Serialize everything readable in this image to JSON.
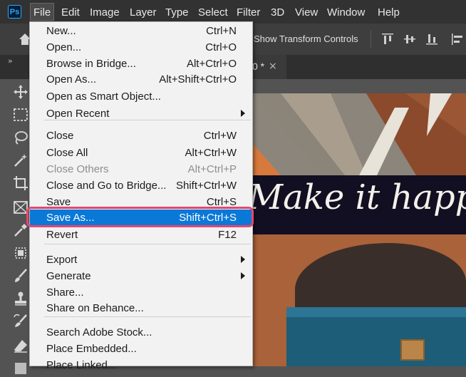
{
  "app": {
    "logo_text": "Ps"
  },
  "menubar": {
    "items": [
      "File",
      "Edit",
      "Image",
      "Layer",
      "Type",
      "Select",
      "Filter",
      "3D",
      "View",
      "Window",
      "Help"
    ],
    "active": "File"
  },
  "options_bar": {
    "transform_controls_label": "Show Transform Controls"
  },
  "tabs": {
    "collapse_glyph": "»",
    "document_tab_suffix": "0 *",
    "close_glyph": "×"
  },
  "canvas": {
    "banner_text": "Make it happen"
  },
  "file_menu": {
    "items": [
      {
        "label": "New...",
        "shortcut": "Ctrl+N"
      },
      {
        "label": "Open...",
        "shortcut": "Ctrl+O"
      },
      {
        "label": "Browse in Bridge...",
        "shortcut": "Alt+Ctrl+O"
      },
      {
        "label": "Open As...",
        "shortcut": "Alt+Shift+Ctrl+O"
      },
      {
        "label": "Open as Smart Object...",
        "shortcut": ""
      },
      {
        "label": "Open Recent",
        "shortcut": "",
        "submenu": true
      },
      {
        "label": "Close",
        "shortcut": "Ctrl+W"
      },
      {
        "label": "Close All",
        "shortcut": "Alt+Ctrl+W"
      },
      {
        "label": "Close Others",
        "shortcut": "Alt+Ctrl+P",
        "disabled": true
      },
      {
        "label": "Close and Go to Bridge...",
        "shortcut": "Shift+Ctrl+W"
      },
      {
        "label": "Save",
        "shortcut": "Ctrl+S"
      },
      {
        "label": "Save As...",
        "shortcut": "Shift+Ctrl+S",
        "highlighted": true
      },
      {
        "label": "Revert",
        "shortcut": "F12"
      },
      {
        "label": "Export",
        "shortcut": "",
        "submenu": true
      },
      {
        "label": "Generate",
        "shortcut": "",
        "submenu": true
      },
      {
        "label": "Share...",
        "shortcut": ""
      },
      {
        "label": "Share on Behance...",
        "shortcut": ""
      },
      {
        "label": "Search Adobe Stock...",
        "shortcut": ""
      },
      {
        "label": "Place Embedded...",
        "shortcut": ""
      },
      {
        "label": "Place Linked...",
        "shortcut": ""
      }
    ]
  },
  "colors": {
    "menu_highlight": "#0a78d7",
    "annotation_ring": "#e8456f",
    "ps_logo": "#31a8ff"
  }
}
